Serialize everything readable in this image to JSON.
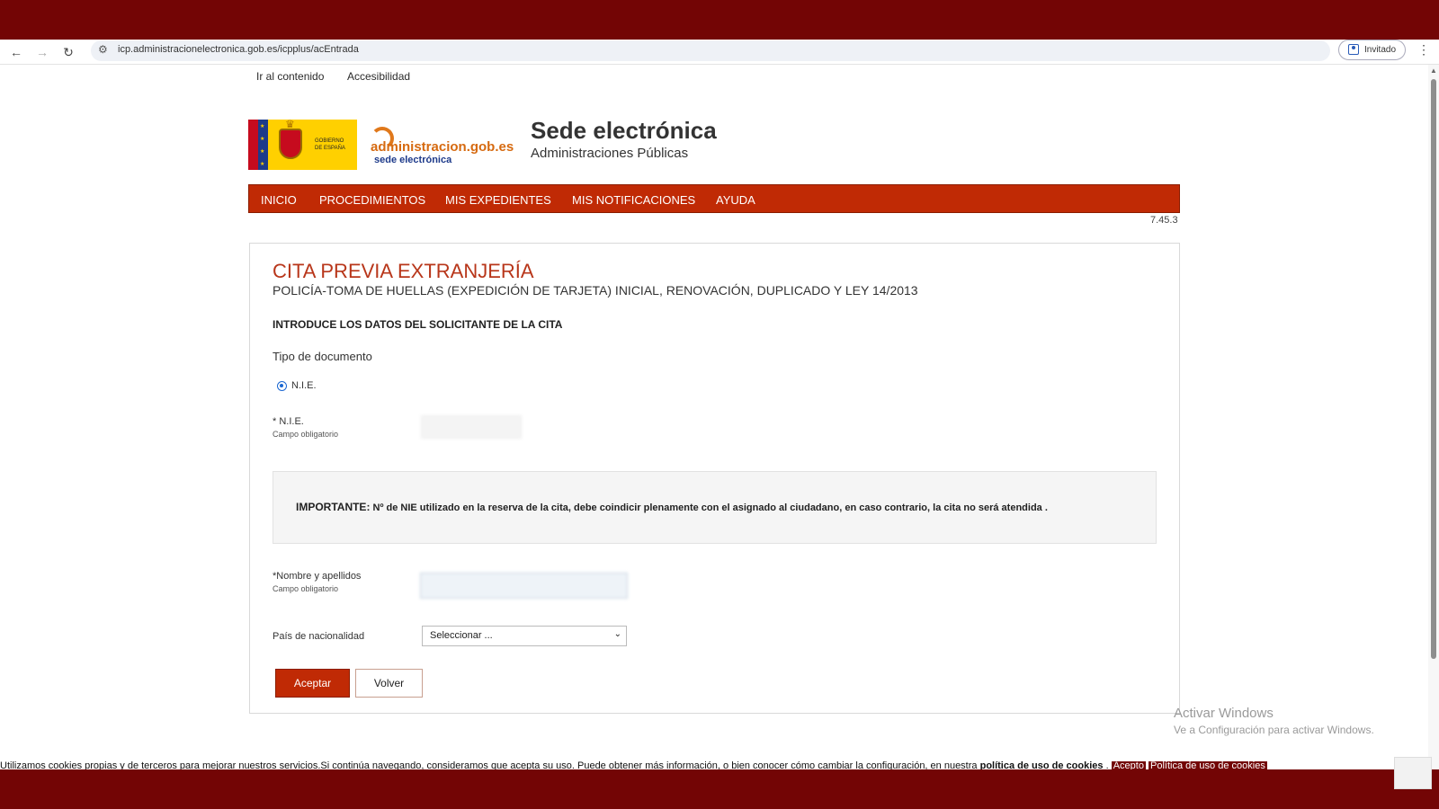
{
  "browser": {
    "url": "icp.administracionelectronica.gob.es/icpplus/acEntrada",
    "guest_label": "Invitado",
    "back_glyph": "←",
    "forward_glyph": "→",
    "reload_glyph": "↻",
    "menu_glyph": "⋮",
    "site_icon_glyph": "⚙"
  },
  "skip_links": {
    "content": "Ir al contenido",
    "accessibility": "Accesibilidad"
  },
  "header": {
    "gov_text": "GOBIERNO DE ESPAÑA",
    "adm_logo_text": "administracion.gob.es",
    "adm_logo_sub": "sede electrónica",
    "title": "Sede electrónica",
    "subtitle": "Administraciones Públicas"
  },
  "nav": {
    "items": [
      "INICIO",
      "PROCEDIMIENTOS",
      "MIS EXPEDIENTES",
      "MIS NOTIFICACIONES",
      "AYUDA"
    ]
  },
  "version": "7.45.3",
  "form": {
    "title": "CITA PREVIA EXTRANJERÍA",
    "subtitle": "POLICÍA-TOMA DE HUELLAS (EXPEDICIÓN DE TARJETA) INICIAL, RENOVACIÓN, DUPLICADO Y LEY 14/2013",
    "section_heading": "INTRODUCE LOS DATOS DEL SOLICITANTE DE LA CITA",
    "doc_type_label": "Tipo de documento",
    "doc_type_option": "N.I.E.",
    "nie_label": "* N.I.E.",
    "nie_required": "Campo obligatorio",
    "nie_value": "",
    "notice_strong": "IMPORTANTE:",
    "notice_text": " Nº de NIE utilizado en la reserva de la cita, debe coindicir plenamente con el asignado al ciudadano, en caso contrario, la cita no será atendida .",
    "name_label": "*Nombre y apellidos",
    "name_required": "Campo obligatorio",
    "name_value": "",
    "country_label": "País de nacionalidad",
    "country_selected": "Seleccionar ...",
    "accept_label": "Aceptar",
    "back_label": "Volver"
  },
  "watermark": {
    "line1": "Activar Windows",
    "line2": "Ve a Configuración para activar Windows."
  },
  "cookies": {
    "text": "Utilizamos cookies propias y de terceros para mejorar nuestros servicios.Si continúa navegando, consideramos que acepta su uso. Puede obtener más información, o bien conocer cómo cambiar la configuración, en nuestra ",
    "policy_link": "política de uso de cookies",
    "accept": "Acepto",
    "policy_button": "Política de uso de cookies"
  },
  "colors": {
    "frame": "#730505",
    "nav": "#c02a05",
    "title": "#b8361a"
  }
}
